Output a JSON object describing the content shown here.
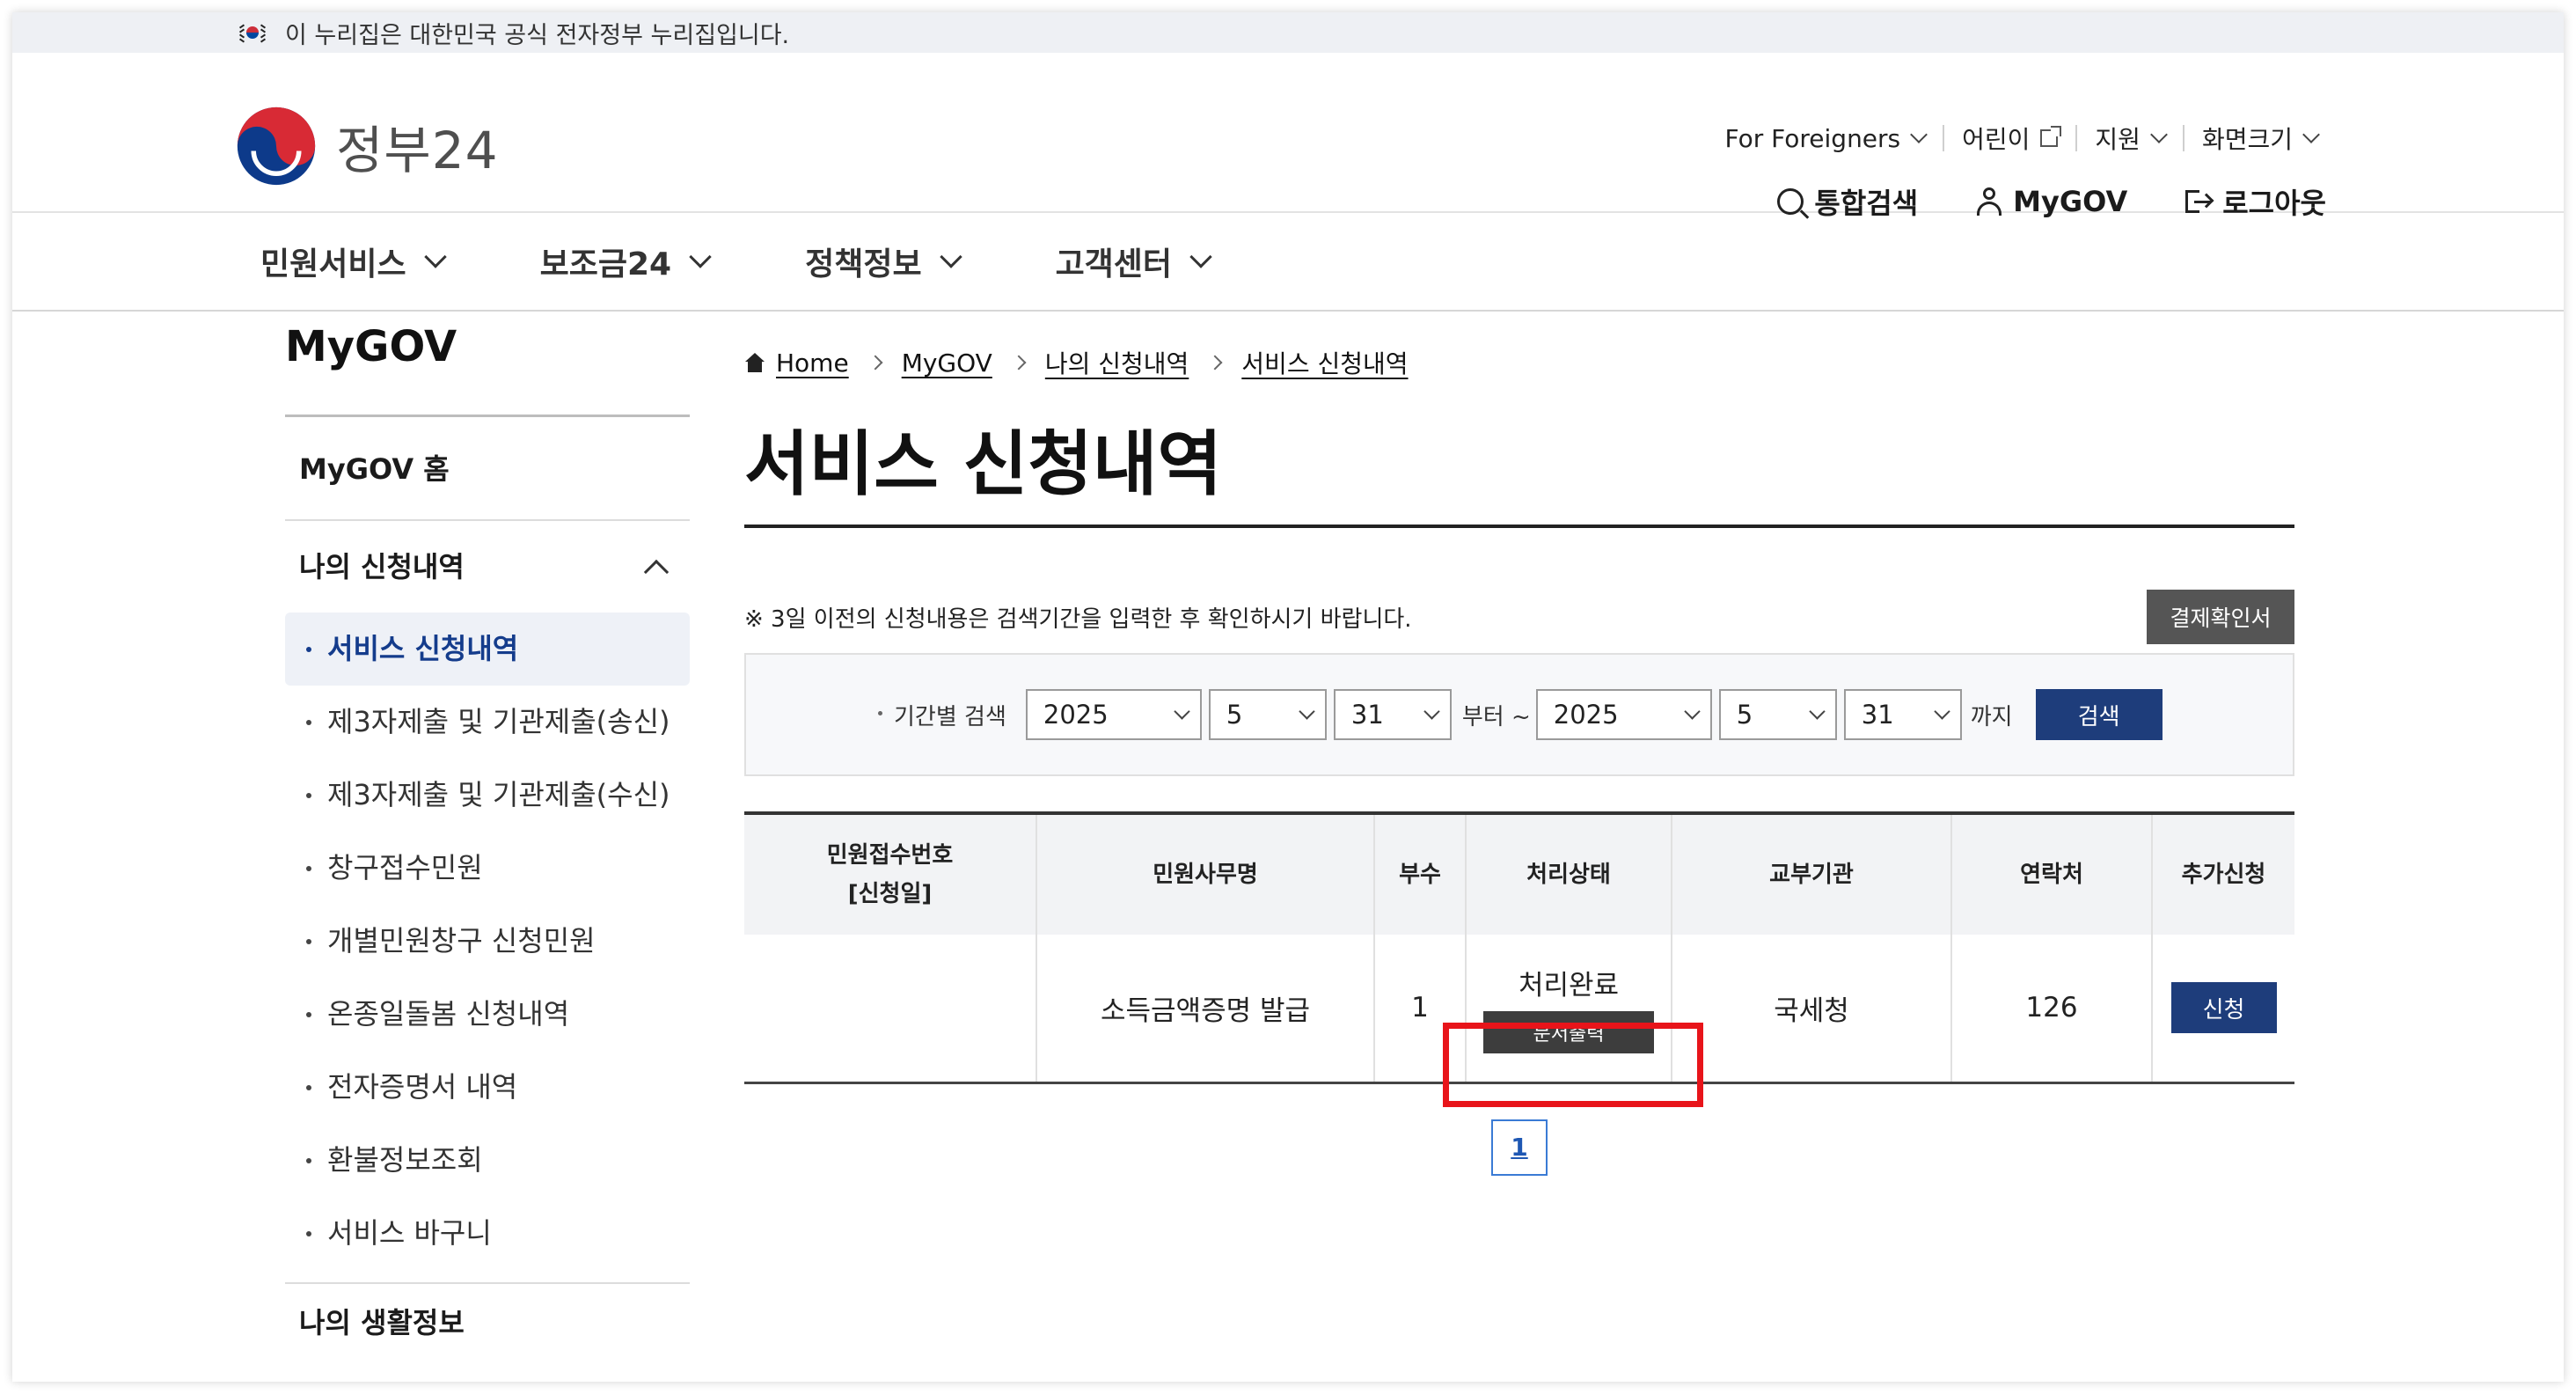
{
  "banner": {
    "text": "이 누리집은 대한민국 공식 전자정부 누리집입니다."
  },
  "logo": {
    "text": "정부24"
  },
  "util_links": [
    {
      "label": "For Foreigners",
      "icon": "chevron-down-icon"
    },
    {
      "label": "어린이",
      "icon": "external-link-icon"
    },
    {
      "label": "지원",
      "icon": "chevron-down-icon"
    },
    {
      "label": "화면크기",
      "icon": "chevron-down-icon"
    }
  ],
  "main_util": {
    "search": "통합검색",
    "mygov": "MyGOV",
    "logout": "로그아웃"
  },
  "gnb": [
    "민원서비스",
    "보조금24",
    "정책정보",
    "고객센터"
  ],
  "sidebar": {
    "title": "MyGOV",
    "home": "MyGOV 홈",
    "group": "나의 신청내역",
    "items": [
      "서비스 신청내역",
      "제3자제출 및 기관제출(송신)",
      "제3자제출 및 기관제출(수신)",
      "창구접수민원",
      "개별민원창구 신청민원",
      "온종일돌봄 신청내역",
      "전자증명서 내역",
      "환불정보조회",
      "서비스 바구니"
    ],
    "active_index": 0,
    "group2": "나의 생활정보"
  },
  "breadcrumb": [
    "Home",
    "MyGOV",
    "나의 신청내역",
    "서비스 신청내역"
  ],
  "page_title": "서비스 신청내역",
  "notice": "※ 3일 이전의 신청내용은 검색기간을 입력한 후 확인하시기 바랍니다.",
  "receipt_button": "결제확인서",
  "search": {
    "label": "기간별 검색",
    "from": {
      "year": "2025",
      "month": "5",
      "day": "31"
    },
    "from_suffix": "부터 ~",
    "to": {
      "year": "2025",
      "month": "5",
      "day": "31"
    },
    "to_suffix": "까지",
    "button": "검색"
  },
  "table": {
    "headers": [
      "민원접수번호",
      "[신청일]",
      "민원사무명",
      "부수",
      "처리상태",
      "교부기관",
      "연락처",
      "추가신청"
    ],
    "rows": [
      {
        "receipt_no": "",
        "service": "소득금액증명 발급",
        "copies": "1",
        "status": "처리완료",
        "print_button": "문서출력",
        "agency": "국세청",
        "contact": "126",
        "apply_button": "신청"
      }
    ]
  },
  "pagination": {
    "current": "1"
  },
  "colors": {
    "primary": "#1e3d7b",
    "highlight": "#e8141a",
    "active_text": "#143c8c"
  }
}
